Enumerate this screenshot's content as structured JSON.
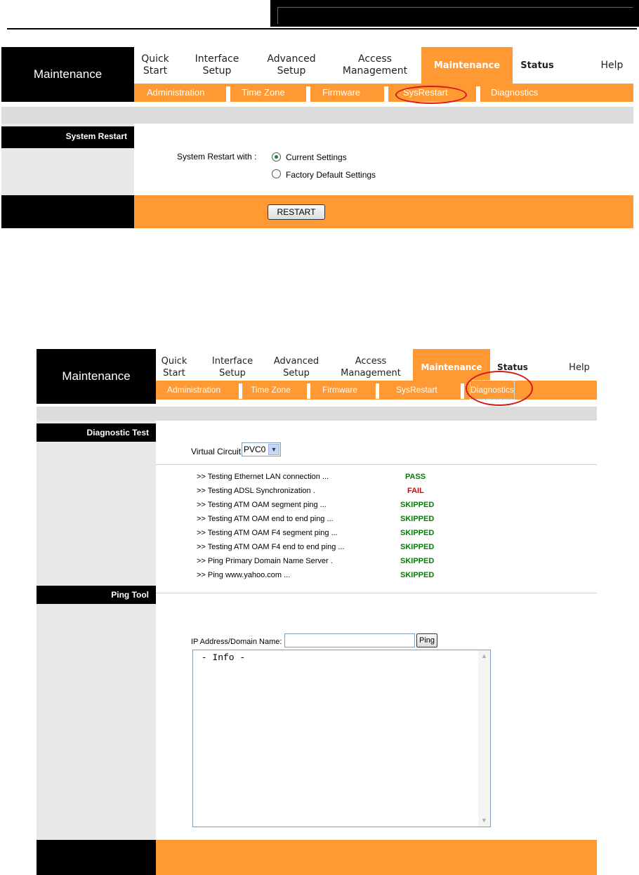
{
  "restart_panel": {
    "brand": "Maintenance",
    "nav": [
      {
        "line1": "Quick",
        "line2": "Start"
      },
      {
        "line1": "Interface",
        "line2": "Setup"
      },
      {
        "line1": "Advanced",
        "line2": "Setup"
      },
      {
        "line1": "Access",
        "line2": "Management"
      },
      {
        "line1": "Maintenance",
        "line2": ""
      },
      {
        "line1": "Status",
        "line2": ""
      },
      {
        "line1": "Help",
        "line2": ""
      }
    ],
    "subnav": [
      "Administration",
      "Time Zone",
      "Firmware",
      "SysRestart",
      "Diagnostics"
    ],
    "section_label": "System Restart",
    "restart_with_label": "System Restart with :",
    "options": [
      "Current Settings",
      "Factory Default Settings"
    ],
    "selected_option": "Current Settings",
    "restart_button": "RESTART"
  },
  "diagnostics_panel": {
    "brand": "Maintenance",
    "nav": [
      {
        "line1": "Quick",
        "line2": "Start"
      },
      {
        "line1": "Interface",
        "line2": "Setup"
      },
      {
        "line1": "Advanced",
        "line2": "Setup"
      },
      {
        "line1": "Access",
        "line2": "Management"
      },
      {
        "line1": "Maintenance",
        "line2": ""
      },
      {
        "line1": "Status",
        "line2": ""
      },
      {
        "line1": "Help",
        "line2": ""
      }
    ],
    "subnav": [
      "Administration",
      "Time Zone",
      "Firmware",
      "SysRestart",
      "Diagnostics"
    ],
    "diag_label": "Diagnostic Test",
    "virtual_circuit_label": "Virtual Circuit:",
    "virtual_circuit_value": "PVC0",
    "tests": [
      {
        "name": ">> Testing Ethernet LAN connection ...",
        "result": "PASS"
      },
      {
        "name": ">> Testing ADSL Synchronization .",
        "result": "FAIL"
      },
      {
        "name": ">> Testing ATM OAM segment ping ...",
        "result": "SKIPPED"
      },
      {
        "name": ">> Testing ATM OAM end to end ping ...",
        "result": "SKIPPED"
      },
      {
        "name": ">> Testing ATM OAM F4 segment ping ...",
        "result": "SKIPPED"
      },
      {
        "name": ">> Testing ATM OAM F4 end to end ping ...",
        "result": "SKIPPED"
      },
      {
        "name": ">> Ping Primary Domain Name Server .",
        "result": "SKIPPED"
      },
      {
        "name": ">> Ping www.yahoo.com ...",
        "result": "SKIPPED"
      }
    ],
    "ping_label": "Ping Tool",
    "ip_label": "IP Address/Domain Name:",
    "ip_value": "",
    "ping_button": "Ping",
    "info_text": " - Info -"
  },
  "colors": {
    "accent": "#ff9933",
    "pass": "#008000",
    "fail": "#dd0000",
    "highlight_circle": "#d41a1a"
  }
}
